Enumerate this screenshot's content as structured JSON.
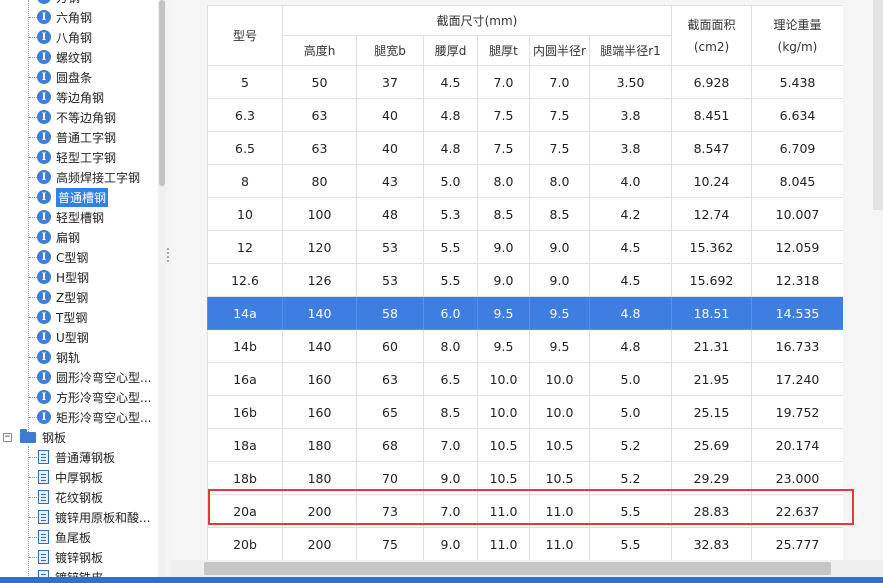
{
  "tree": {
    "top_partial": "方钢",
    "items": [
      "六角钢",
      "八角钢",
      "螺纹钢",
      "圆盘条",
      "等边角钢",
      "不等边角钢",
      "普通工字钢",
      "轻型工字钢",
      "高频焊接工字钢",
      "普通槽钢",
      "轻型槽钢",
      "扁钢",
      "C型钢",
      "H型钢",
      "Z型钢",
      "T型钢",
      "U型钢",
      "钢轨",
      "圆形冷弯空心型...",
      "方形冷弯空心型...",
      "矩形冷弯空心型..."
    ],
    "selected_index": 9,
    "folder": "钢板",
    "folder_expander": "−",
    "sub_items": [
      "普通薄钢板",
      "中厚钢板",
      "花纹钢板",
      "镀锌用原板和酸...",
      "鱼尾板",
      "镀锌钢板",
      "镀锌铁皮"
    ],
    "icon_letter": "I"
  },
  "table": {
    "headers": {
      "model": "型号",
      "section_group": "截面尺寸(mm)",
      "sub": [
        "高度h",
        "腿宽b",
        "腰厚d",
        "腿厚t",
        "内圆半径r",
        "腿端半径r1"
      ],
      "area_line1": "截面面积",
      "area_line2": "(cm2)",
      "weight_line1": "理论重量",
      "weight_line2": "(kg/m)"
    },
    "rows": [
      [
        "5",
        "50",
        "37",
        "4.5",
        "7.0",
        "7.0",
        "3.50",
        "6.928",
        "5.438"
      ],
      [
        "6.3",
        "63",
        "40",
        "4.8",
        "7.5",
        "7.5",
        "3.8",
        "8.451",
        "6.634"
      ],
      [
        "6.5",
        "63",
        "40",
        "4.8",
        "7.5",
        "7.5",
        "3.8",
        "8.547",
        "6.709"
      ],
      [
        "8",
        "80",
        "43",
        "5.0",
        "8.0",
        "8.0",
        "4.0",
        "10.24",
        "8.045"
      ],
      [
        "10",
        "100",
        "48",
        "5.3",
        "8.5",
        "8.5",
        "4.2",
        "12.74",
        "10.007"
      ],
      [
        "12",
        "120",
        "53",
        "5.5",
        "9.0",
        "9.0",
        "4.5",
        "15.362",
        "12.059"
      ],
      [
        "12.6",
        "126",
        "53",
        "5.5",
        "9.0",
        "9.0",
        "4.5",
        "15.692",
        "12.318"
      ],
      [
        "14a",
        "140",
        "58",
        "6.0",
        "9.5",
        "9.5",
        "4.8",
        "18.51",
        "14.535"
      ],
      [
        "14b",
        "140",
        "60",
        "8.0",
        "9.5",
        "9.5",
        "4.8",
        "21.31",
        "16.733"
      ],
      [
        "16a",
        "160",
        "63",
        "6.5",
        "10.0",
        "10.0",
        "5.0",
        "21.95",
        "17.240"
      ],
      [
        "16b",
        "160",
        "65",
        "8.5",
        "10.0",
        "10.0",
        "5.0",
        "25.15",
        "19.752"
      ],
      [
        "18a",
        "180",
        "68",
        "7.0",
        "10.5",
        "10.5",
        "5.2",
        "25.69",
        "20.174"
      ],
      [
        "18b",
        "180",
        "70",
        "9.0",
        "10.5",
        "10.5",
        "5.2",
        "29.29",
        "23.000"
      ],
      [
        "20a",
        "200",
        "73",
        "7.0",
        "11.0",
        "11.0",
        "5.5",
        "28.83",
        "22.637"
      ],
      [
        "20b",
        "200",
        "75",
        "9.0",
        "11.0",
        "11.0",
        "5.5",
        "32.83",
        "25.777"
      ]
    ],
    "selected_row": 7,
    "highlighted_row": 13
  },
  "colors": {
    "selection": "#3d7ee0",
    "highlight_box": "#e53935",
    "icon_blue": "#3d7ed8"
  }
}
